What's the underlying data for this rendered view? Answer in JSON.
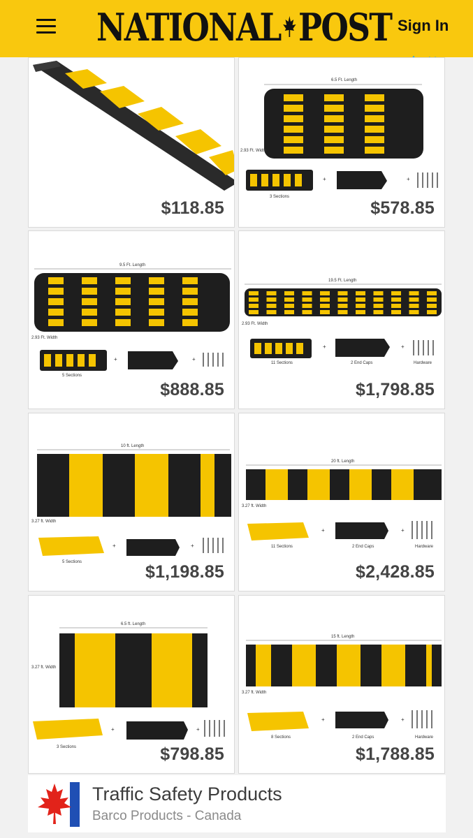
{
  "header": {
    "logo_left": "NATIONAL",
    "logo_right": "POST",
    "sign_in": "Sign In"
  },
  "colors": {
    "brand_yellow": "#f9c80e",
    "bump_yellow": "#f5c400",
    "bump_black": "#1e1e1e",
    "price_text": "#444444"
  },
  "products": [
    {
      "price": "$118.85"
    },
    {
      "price": "$578.85",
      "length_label": "6.5 Ft. Length",
      "width_label": "2.93 Ft. Width",
      "sections_label": "3 Sections"
    },
    {
      "price": "$888.85",
      "length_label": "9.5 Ft. Length",
      "width_label": "2.93 Ft. Width",
      "sections_label": "5 Sections"
    },
    {
      "price": "$1,798.85",
      "length_label": "19.5 Ft. Length",
      "width_label": "2.93 Ft. Width",
      "sections_label": "11 Sections",
      "caps_label": "2 End Caps",
      "hardware_label": "Hardware"
    },
    {
      "price": "$1,198.85",
      "length_label": "10 ft. Length",
      "width_label": "3.27 ft. Width",
      "sections_label": "5 Sections"
    },
    {
      "price": "$2,428.85",
      "length_label": "20 ft. Length",
      "width_label": "3.27 ft. Width",
      "sections_label": "11 Sections",
      "caps_label": "2 End Caps",
      "hardware_label": "Hardware"
    },
    {
      "price": "$798.85",
      "length_label": "6.5 ft. Length",
      "width_label": "3.27 ft. Width",
      "sections_label": "3 Sections"
    },
    {
      "price": "$1,788.85",
      "length_label": "15 ft. Length",
      "width_label": "3.27 ft. Width",
      "sections_label": "8 Sections",
      "caps_label": "2 End Caps",
      "hardware_label": "Hardware"
    }
  ],
  "ad": {
    "title": "Traffic Safety Products",
    "subtitle": "Barco Products - Canada"
  }
}
